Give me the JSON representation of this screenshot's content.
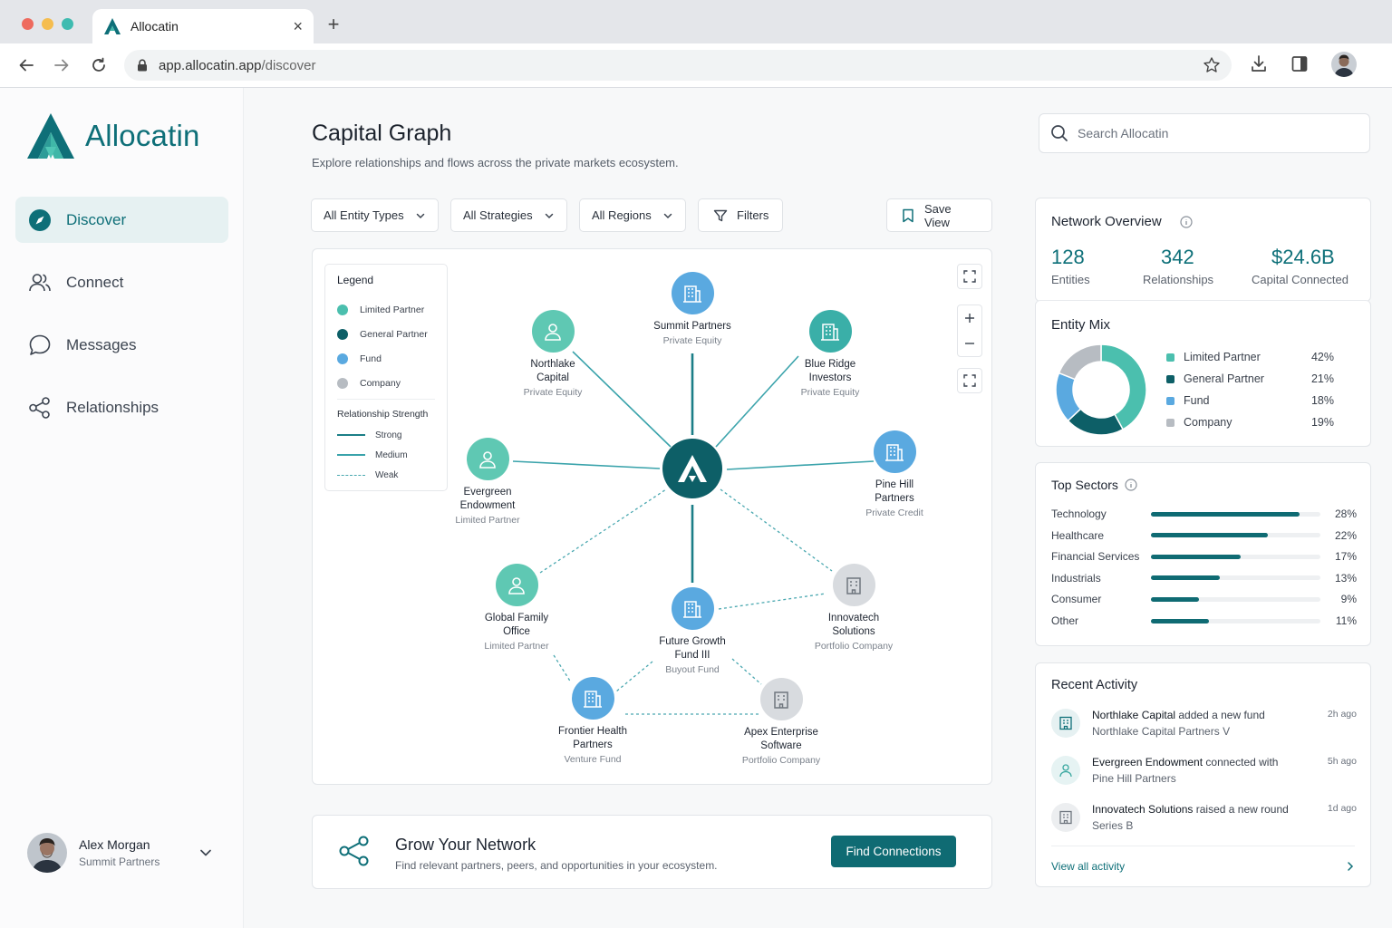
{
  "browser": {
    "tab_title": "Allocatin",
    "url_host": "app.allocatin.app",
    "url_path": "/discover"
  },
  "colors": {
    "brand": "#0e6f78",
    "limited_partner": "#4bbfae",
    "general_partner": "#0d5f67",
    "fund": "#5aa9e0",
    "company": "#b7bcc2"
  },
  "sidebar": {
    "brand_name": "Allocatin",
    "items": [
      {
        "label": "Discover",
        "icon": "compass-icon",
        "active": true
      },
      {
        "label": "Connect",
        "icon": "users-icon"
      },
      {
        "label": "Messages",
        "icon": "chat-bubble-icon"
      },
      {
        "label": "Relationships",
        "icon": "share-nodes-icon"
      }
    ],
    "user": {
      "name": "Alex Morgan",
      "org": "Summit Partners"
    }
  },
  "header": {
    "title": "Capital Graph",
    "subtitle": "Explore relationships and flows across the private markets ecosystem.",
    "search_placeholder": "Search Allocatin"
  },
  "filters": {
    "entity_types": "All Entity Types",
    "strategies": "All Strategies",
    "regions": "All Regions",
    "filters": "Filters",
    "save_view": "Save View"
  },
  "legend": {
    "title": "Legend",
    "entities": [
      "Limited Partner",
      "General Partner",
      "Fund",
      "Company"
    ],
    "strength_title": "Relationship Strength",
    "strengths": [
      "Strong",
      "Medium",
      "Weak"
    ]
  },
  "graph": {
    "nodes": [
      {
        "name_1": "Summit Partners",
        "name_2": "",
        "type": "Private Equity",
        "kind": "fund"
      },
      {
        "name_1": "Northlake",
        "name_2": "Capital",
        "type": "Private Equity",
        "kind": "lp"
      },
      {
        "name_1": "Blue Ridge",
        "name_2": "Investors",
        "type": "Private Equity",
        "kind": "fund"
      },
      {
        "name_1": "Evergreen",
        "name_2": "Endowment",
        "type": "Limited Partner",
        "kind": "lp"
      },
      {
        "name_1": "Pine Hill",
        "name_2": "Partners",
        "type": "Private Credit",
        "kind": "fund"
      },
      {
        "name_1": "Global Family",
        "name_2": "Office",
        "type": "Limited Partner",
        "kind": "lp"
      },
      {
        "name_1": "Future Growth",
        "name_2": "Fund III",
        "type": "Buyout Fund",
        "kind": "fund"
      },
      {
        "name_1": "Innovatech",
        "name_2": "Solutions",
        "type": "Portfolio Company",
        "kind": "company"
      },
      {
        "name_1": "Frontier Health",
        "name_2": "Partners",
        "type": "Venture Fund",
        "kind": "fund"
      },
      {
        "name_1": "Apex Enterprise",
        "name_2": "Software",
        "type": "Portfolio Company",
        "kind": "company"
      }
    ]
  },
  "grow": {
    "title": "Grow Your Network",
    "subtitle": "Find relevant partners, peers, and opportunities in your ecosystem.",
    "cta": "Find Connections"
  },
  "overview": {
    "title": "Network Overview",
    "stats": [
      {
        "value": "128",
        "label": "Entities"
      },
      {
        "value": "342",
        "label": "Relationships"
      },
      {
        "value": "$24.6B",
        "label": "Capital Connected"
      }
    ]
  },
  "entity_mix": {
    "title": "Entity Mix",
    "rows": [
      {
        "label": "Limited Partner",
        "pct": "42%",
        "value": 42
      },
      {
        "label": "General Partner",
        "pct": "21%",
        "value": 21
      },
      {
        "label": "Fund",
        "pct": "18%",
        "value": 18
      },
      {
        "label": "Company",
        "pct": "19%",
        "value": 19
      }
    ]
  },
  "sectors": {
    "title": "Top Sectors",
    "rows": [
      {
        "label": "Technology",
        "pct": "28%",
        "value": 28
      },
      {
        "label": "Healthcare",
        "pct": "22%",
        "value": 22
      },
      {
        "label": "Financial Services",
        "pct": "17%",
        "value": 17
      },
      {
        "label": "Industrials",
        "pct": "13%",
        "value": 13
      },
      {
        "label": "Consumer",
        "pct": "9%",
        "value": 9
      },
      {
        "label": "Other",
        "pct": "11%",
        "value": 11
      }
    ]
  },
  "activity": {
    "title": "Recent Activity",
    "items": [
      {
        "actor": "Northlake Capital",
        "action": " added a new fund",
        "detail": "Northlake Capital Partners V",
        "time": "2h ago",
        "icon": "building-icon"
      },
      {
        "actor": "Evergreen Endowment",
        "action": " connected with",
        "detail": "Pine Hill Partners",
        "time": "5h ago",
        "icon": "person-icon"
      },
      {
        "actor": "Innovatech Solutions",
        "action": " raised a new round",
        "detail": "Series B",
        "time": "1d ago",
        "icon": "company-icon"
      }
    ],
    "view_all": "View all activity"
  }
}
